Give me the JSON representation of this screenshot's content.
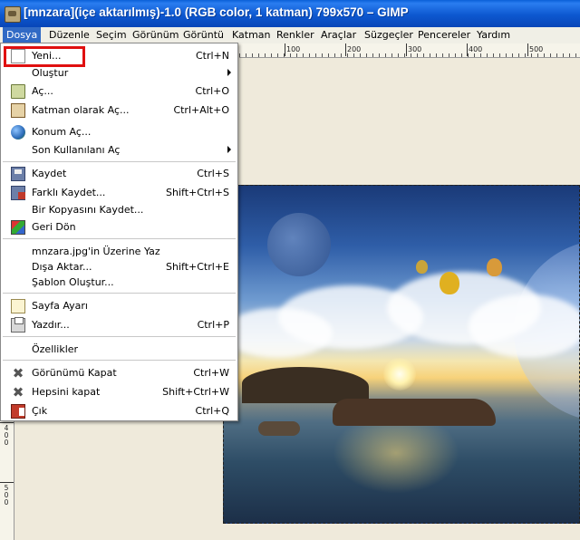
{
  "window": {
    "title": "[mnzara](içe aktarılmış)-1.0 (RGB color, 1 katman) 799x570 – GIMP"
  },
  "menubar": {
    "items": [
      {
        "label": "Dosya",
        "active": true
      },
      {
        "label": "Düzenle"
      },
      {
        "label": "Seçim"
      },
      {
        "label": "Görünüm"
      },
      {
        "label": "Görüntü"
      },
      {
        "label": "Katman"
      },
      {
        "label": "Renkler"
      },
      {
        "label": "Araçlar"
      },
      {
        "label": "Süzgeçler"
      },
      {
        "label": "Pencereler"
      },
      {
        "label": "Yardım"
      }
    ]
  },
  "ruler": {
    "h_ticks": [
      "100",
      "200",
      "300",
      "400",
      "500"
    ],
    "v_ticks": [
      "4",
      "0",
      "0",
      "5",
      "0",
      "0"
    ]
  },
  "file_menu": {
    "items": [
      {
        "label": "Yeni...",
        "shortcut": "Ctrl+N",
        "icon": "new-document-icon",
        "highlighted": true
      },
      {
        "label": "Oluştur",
        "submenu": true
      },
      {
        "label": "Aç...",
        "shortcut": "Ctrl+O",
        "icon": "folder-open-icon"
      },
      {
        "label": "Katman olarak Aç...",
        "shortcut": "Ctrl+Alt+O",
        "icon": "layer-open-icon"
      },
      {
        "label": "Konum Aç...",
        "icon": "globe-icon"
      },
      {
        "label": "Son Kullanılanı Aç",
        "submenu": true
      },
      {
        "label": "Kaydet",
        "shortcut": "Ctrl+S",
        "icon": "save-icon"
      },
      {
        "label": "Farklı Kaydet...",
        "shortcut": "Shift+Ctrl+S",
        "icon": "save-as-icon"
      },
      {
        "label": "Bir Kopyasını Kaydet..."
      },
      {
        "label": "Geri Dön",
        "icon": "revert-icon"
      },
      {
        "label": "mnzara.jpg'in Üzerine Yaz"
      },
      {
        "label": "Dışa Aktar...",
        "shortcut": "Shift+Ctrl+E"
      },
      {
        "label": "Şablon Oluştur..."
      },
      {
        "label": "Sayfa Ayarı",
        "icon": "page-setup-icon"
      },
      {
        "label": "Yazdır...",
        "shortcut": "Ctrl+P",
        "icon": "print-icon"
      },
      {
        "label": "Özellikler"
      },
      {
        "label": "Görünümü Kapat",
        "shortcut": "Ctrl+W",
        "icon": "close-icon"
      },
      {
        "label": "Hepsini kapat",
        "shortcut": "Shift+Ctrl+W",
        "icon": "close-all-icon"
      },
      {
        "label": "Çık",
        "shortcut": "Ctrl+Q",
        "icon": "quit-icon"
      }
    ]
  },
  "colors": {
    "titlebar": "#0a5fd8",
    "menu_highlight": "#316ac5",
    "annotation_box": "#e01010"
  }
}
